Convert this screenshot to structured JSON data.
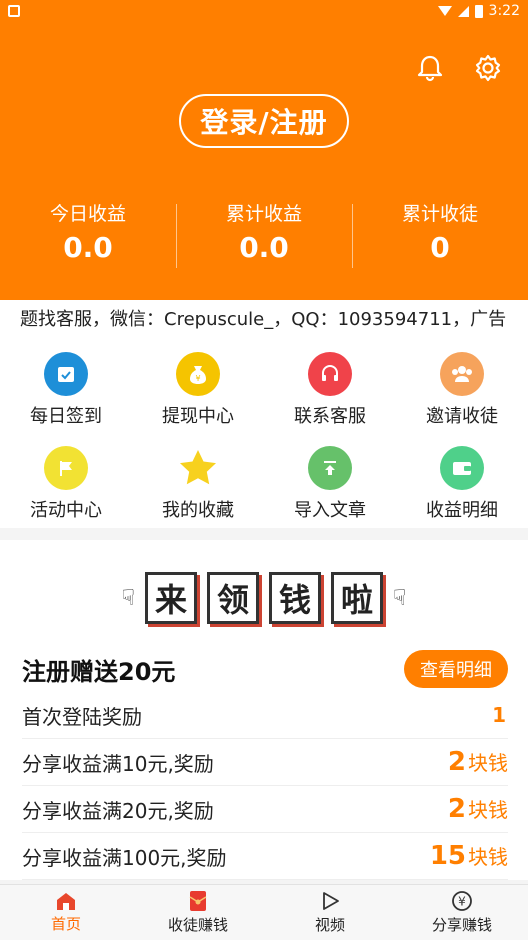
{
  "status_bar": {
    "time": "3:22"
  },
  "header": {
    "login_label": "登录/注册",
    "stats": [
      {
        "label": "今日收益",
        "value": "0.0"
      },
      {
        "label": "累计收益",
        "value": "0.0"
      },
      {
        "label": "累计收徒",
        "value": "0"
      }
    ],
    "icons": [
      "bell-icon",
      "gear-icon"
    ]
  },
  "marquee": {
    "text": "题找客服，微信：Crepuscule_，QQ：1093594711，广告"
  },
  "grid": {
    "items": [
      {
        "label": "每日签到",
        "icon": "calendar-check-icon",
        "color": "#1e8fd8"
      },
      {
        "label": "提现中心",
        "icon": "money-bag-icon",
        "color": "#f5c400"
      },
      {
        "label": "联系客服",
        "icon": "headset-icon",
        "color": "#f0434a"
      },
      {
        "label": "邀请收徒",
        "icon": "users-icon",
        "color": "#f6a35c"
      },
      {
        "label": "活动中心",
        "icon": "flag-icon",
        "color": "#f2e233"
      },
      {
        "label": "我的收藏",
        "icon": "star-icon",
        "color": "#f7d11e"
      },
      {
        "label": "导入文章",
        "icon": "upload-icon",
        "color": "#66c16a"
      },
      {
        "label": "收益明细",
        "icon": "wallet-icon",
        "color": "#4fd08a"
      }
    ]
  },
  "reward": {
    "banner_chars": [
      "来",
      "领",
      "钱",
      "啦"
    ],
    "title": "注册赠送20元",
    "detail_button": "查看明细",
    "rows": [
      {
        "label": "首次登陆奖励",
        "amount": "1",
        "unit": ""
      },
      {
        "label": "分享收益满10元,奖励",
        "amount": "2",
        "unit": "块钱"
      },
      {
        "label": "分享收益满20元,奖励",
        "amount": "2",
        "unit": "块钱"
      },
      {
        "label": "分享收益满100元,奖励",
        "amount": "15",
        "unit": "块钱"
      }
    ]
  },
  "bottom_nav": {
    "items": [
      {
        "label": "首页",
        "icon": "home-icon",
        "active": true
      },
      {
        "label": "收徒赚钱",
        "icon": "red-envelope-icon",
        "active": false
      },
      {
        "label": "视频",
        "icon": "play-icon",
        "active": false
      },
      {
        "label": "分享赚钱",
        "icon": "yuan-icon",
        "active": false
      }
    ]
  },
  "colors": {
    "brand": "#ff7f00",
    "active_nav": "#ff6a00"
  }
}
